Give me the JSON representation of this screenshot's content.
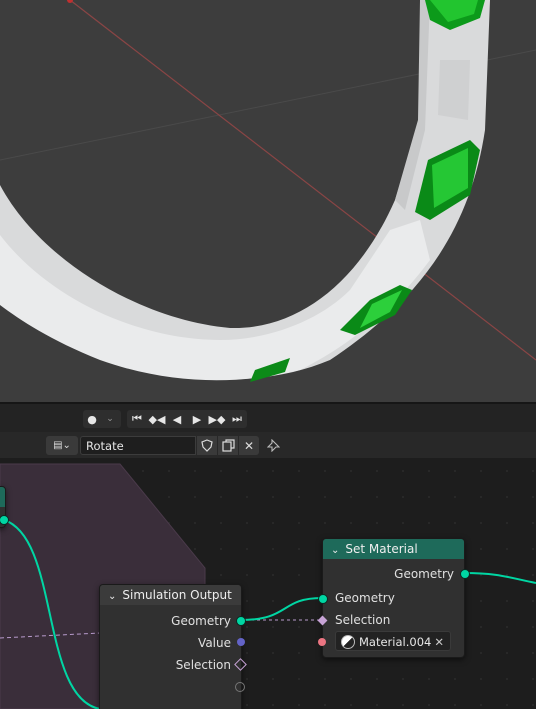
{
  "timeline": {
    "record_icon": "record-dot-icon",
    "buttons": [
      "jump-start-icon",
      "prev-keyframe-icon",
      "play-reverse-icon",
      "play-icon",
      "next-keyframe-icon",
      "jump-end-icon"
    ]
  },
  "node_header": {
    "node_group_name": "Rotate",
    "icons": [
      "node-editor-type-icon",
      "fake-user-shield-icon",
      "duplicate-icon",
      "close-icon",
      "pin-icon"
    ]
  },
  "nodes": {
    "simulation_output": {
      "title": "Simulation Output",
      "inputs": [
        "Geometry",
        "Value",
        "Selection"
      ]
    },
    "set_material": {
      "title": "Set Material",
      "output": "Geometry",
      "inputs": [
        "Geometry",
        "Selection"
      ],
      "material": "Material.004"
    }
  },
  "colors": {
    "geometry_socket": "#00d6a3",
    "set_material_header": "#1e6a5a",
    "simulation_frame": "#3a2e3a",
    "viewport_bg": "#3d3d3d",
    "gem": "#0c9a1a"
  }
}
